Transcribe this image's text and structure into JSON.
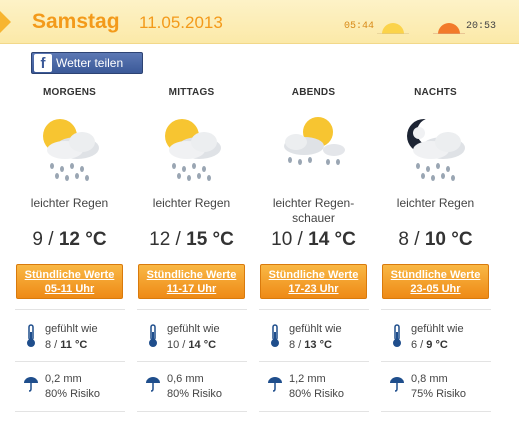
{
  "header": {
    "day": "Samstag",
    "date": "11.05.2013",
    "sunrise": "05:44",
    "sunset": "20:53",
    "sunrise_icon": "sunrise-icon",
    "sunset_icon": "sunset-icon"
  },
  "share": {
    "label": "Wetter teilen",
    "icon": "facebook-icon"
  },
  "periods": [
    {
      "title": "MORGENS",
      "icon": "sun-cloud-rain-icon",
      "condition": "leichter Regen",
      "temp_min": "9",
      "temp_max": "12 °C",
      "button_line1": "Stündliche Werte",
      "button_line2": "05-11 Uhr",
      "feels_label": "gefühlt wie",
      "feels_min": "8",
      "feels_max": "11 °C",
      "rain_mm": "0,2 mm",
      "rain_risk": "80% Risiko"
    },
    {
      "title": "MITTAGS",
      "icon": "sun-cloud-rain-icon",
      "condition": "leichter Regen",
      "temp_min": "12",
      "temp_max": "15 °C",
      "button_line1": "Stündliche Werte",
      "button_line2": "11-17 Uhr",
      "feels_label": "gefühlt wie",
      "feels_min": "10",
      "feels_max": "14 °C",
      "rain_mm": "0,6 mm",
      "rain_risk": "80% Risiko"
    },
    {
      "title": "ABENDS",
      "icon": "sun-cloud-showers-icon",
      "condition": "leichter Regen-schauer",
      "temp_min": "10",
      "temp_max": "14 °C",
      "button_line1": "Stündliche Werte",
      "button_line2": "17-23 Uhr",
      "feels_label": "gefühlt wie",
      "feels_min": "8",
      "feels_max": "13 °C",
      "rain_mm": "1,2 mm",
      "rain_risk": "80% Risiko"
    },
    {
      "title": "NACHTS",
      "icon": "moon-cloud-rain-icon",
      "condition": "leichter Regen",
      "temp_min": "8",
      "temp_max": "10 °C",
      "button_line1": "Stündliche Werte",
      "button_line2": "23-05 Uhr",
      "feels_label": "gefühlt wie",
      "feels_min": "6",
      "feels_max": "9 °C",
      "rain_mm": "0,8 mm",
      "rain_risk": "75% Risiko"
    }
  ],
  "colors": {
    "accent": "#f39a1a",
    "button": "#ee8a16",
    "facebook": "#3b5998"
  }
}
